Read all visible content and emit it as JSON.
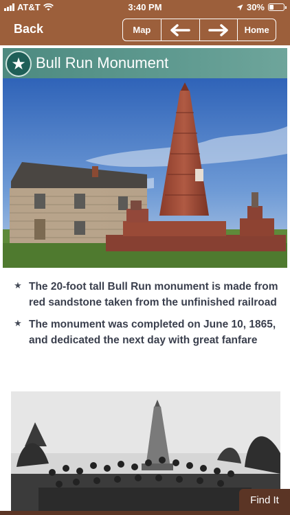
{
  "status_bar": {
    "carrier": "AT&T",
    "time": "3:40 PM",
    "battery_text": "30%",
    "battery_level": 0.3
  },
  "nav": {
    "back_label": "Back",
    "map_label": "Map",
    "prev_icon": "arrow-left-icon",
    "next_icon": "arrow-right-icon",
    "home_label": "Home"
  },
  "header": {
    "title": "Bull Run Monument",
    "badge_icon": "star-icon"
  },
  "bullets": [
    {
      "text": "The 20-foot tall Bull Run monument is made from red sandstone taken from the unfinished railroad"
    },
    {
      "text": "The monument was completed on June 10, 1865, and dedicated the next day with great fanfare"
    }
  ],
  "footer": {
    "find_it_label": "Find It"
  },
  "colors": {
    "bar": "#9c5f3b",
    "header_band": "#5f9a90",
    "find_button": "#5b3525"
  }
}
